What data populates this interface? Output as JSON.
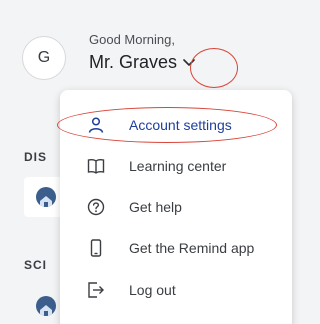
{
  "header": {
    "avatar_initial": "G",
    "greeting": "Good Morning,",
    "user_name": "Mr. Graves"
  },
  "sidebar": {
    "districts_label": "DIS",
    "schools_label": "SCI"
  },
  "menu": {
    "items": [
      {
        "label": "Account settings",
        "icon": "person-icon"
      },
      {
        "label": "Learning center",
        "icon": "book-icon"
      },
      {
        "label": "Get help",
        "icon": "help-icon"
      },
      {
        "label": "Get the Remind app",
        "icon": "phone-icon"
      },
      {
        "label": "Log out",
        "icon": "logout-icon"
      }
    ]
  },
  "colors": {
    "accent": "#1f3f9b",
    "annotation": "#d9453a",
    "background": "#f3f4f5"
  }
}
